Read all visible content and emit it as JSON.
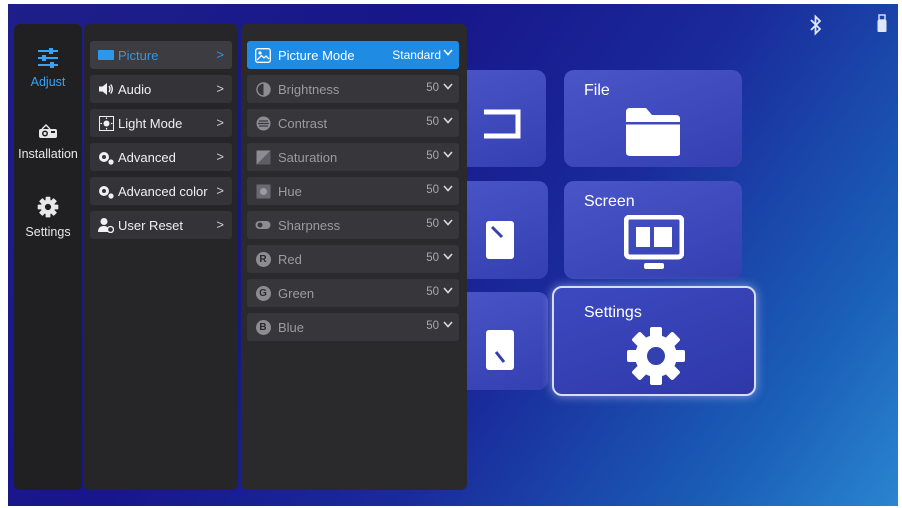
{
  "status_icons": [
    "bluetooth-icon",
    "usb-icon"
  ],
  "tiles": [
    {
      "label": "File",
      "icon": "folder-icon"
    },
    {
      "label": "Screen",
      "icon": "screen-icon"
    },
    {
      "label": "Settings",
      "icon": "gear-icon",
      "focused": true
    }
  ],
  "nav": {
    "items": [
      {
        "label": "Adjust",
        "icon": "sliders-icon",
        "active": true
      },
      {
        "label": "Installation",
        "icon": "projector-icon"
      },
      {
        "label": "Settings",
        "icon": "gear-icon"
      }
    ]
  },
  "menu": {
    "items": [
      {
        "label": "Picture",
        "icon": "picture-icon",
        "active": true
      },
      {
        "label": "Audio",
        "icon": "speaker-icon"
      },
      {
        "label": "Light Mode",
        "icon": "light-icon"
      },
      {
        "label": "Advanced",
        "icon": "gears-icon"
      },
      {
        "label": "Advanced color",
        "icon": "color-gears-icon"
      },
      {
        "label": "User Reset",
        "icon": "user-reset-icon"
      }
    ],
    "chevron": ">"
  },
  "picture": {
    "mode": {
      "label": "Picture Mode",
      "value": "Standard"
    },
    "items": [
      {
        "label": "Brightness",
        "value": "50",
        "icon": "brightness-icon"
      },
      {
        "label": "Contrast",
        "value": "50",
        "icon": "contrast-icon"
      },
      {
        "label": "Saturation",
        "value": "50",
        "icon": "saturation-icon"
      },
      {
        "label": "Hue",
        "value": "50",
        "icon": "hue-icon"
      },
      {
        "label": "Sharpness",
        "value": "50",
        "icon": "sharpness-icon"
      },
      {
        "label": "Red",
        "value": "50",
        "icon": "red-icon",
        "letter": "R"
      },
      {
        "label": "Green",
        "value": "50",
        "icon": "green-icon",
        "letter": "G"
      },
      {
        "label": "Blue",
        "value": "50",
        "icon": "blue-icon",
        "letter": "B"
      }
    ]
  },
  "colors": {
    "accent": "#1f8be2",
    "active_text": "#2f97ea",
    "panel": "#2a2a2d"
  }
}
